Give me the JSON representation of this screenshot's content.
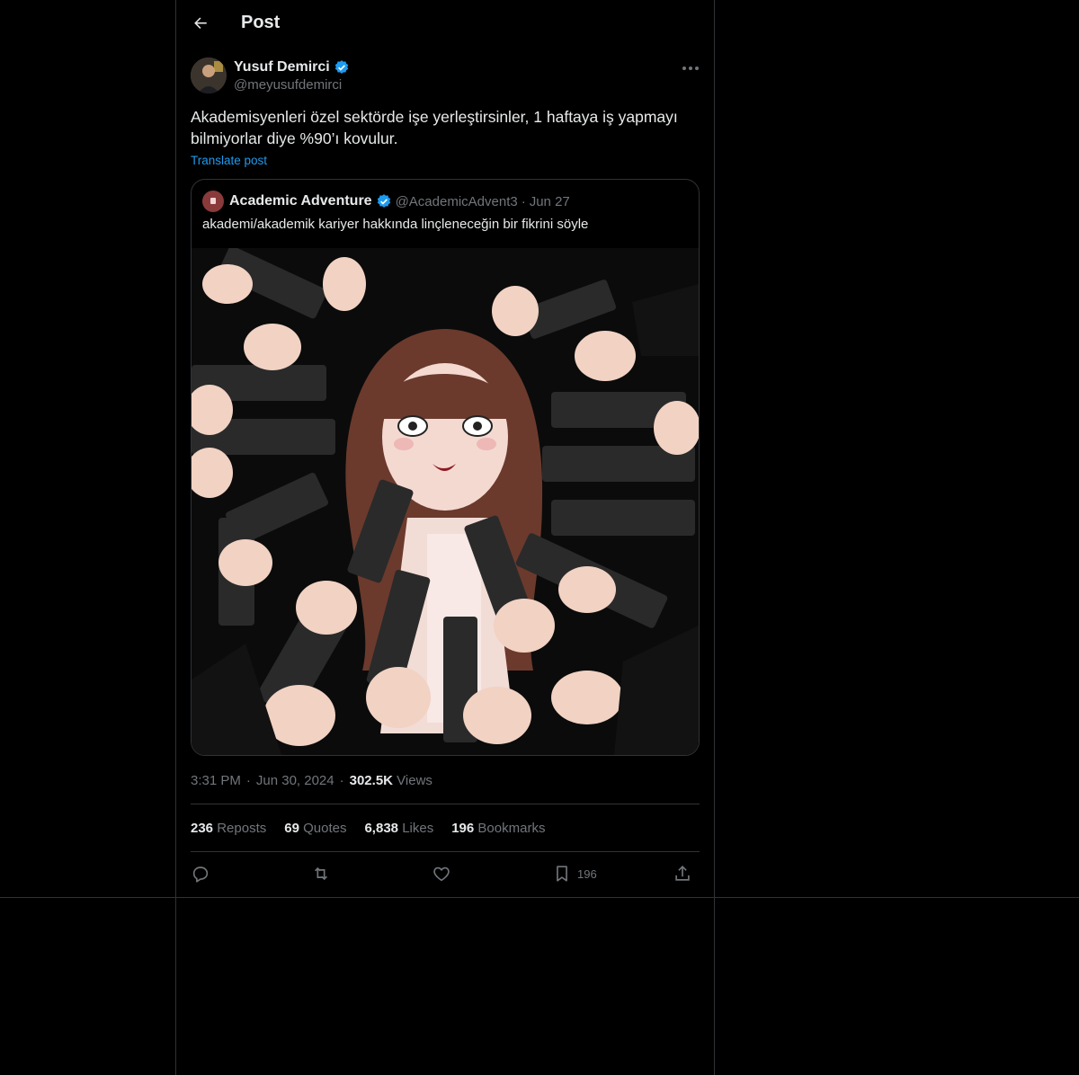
{
  "header": {
    "title": "Post",
    "back_icon": "arrow-left-icon"
  },
  "author": {
    "name": "Yusuf Demirci",
    "handle": "@meyusufdemirci",
    "verified": true,
    "verified_color": "#1d9bf0"
  },
  "post": {
    "text": "Akademisyenleri özel sektörde işe yerleştirsinler, 1 haftaya iş yapmayı bilmiyorlar diye %90’ı kovulur.",
    "translate_label": "Translate post"
  },
  "quote": {
    "name": "Academic Adventure",
    "handle": "@AcademicAdvent3",
    "separator": "·",
    "date": "Jun 27",
    "text": "akademi/akademik kariyer hakkında linçleneceğin bir fikrini söyle",
    "media_description_icon": "image-illustration"
  },
  "meta": {
    "time": "3:31 PM",
    "separator": "·",
    "date": "Jun 30, 2024",
    "views_count": "302.5K",
    "views_label": "Views"
  },
  "stats": {
    "reposts_count": "236",
    "reposts_label": "Reposts",
    "quotes_count": "69",
    "quotes_label": "Quotes",
    "likes_count": "6,838",
    "likes_label": "Likes",
    "bookmarks_count": "196",
    "bookmarks_label": "Bookmarks"
  },
  "actions": {
    "reply_icon": "reply-icon",
    "repost_icon": "repost-icon",
    "like_icon": "heart-icon",
    "bookmark_icon": "bookmark-icon",
    "bookmark_count": "196",
    "share_icon": "share-icon"
  },
  "colors": {
    "background": "#000000",
    "text": "#e7e9ea",
    "muted": "#71767b",
    "border": "#2f3336",
    "accent": "#1d9bf0"
  }
}
